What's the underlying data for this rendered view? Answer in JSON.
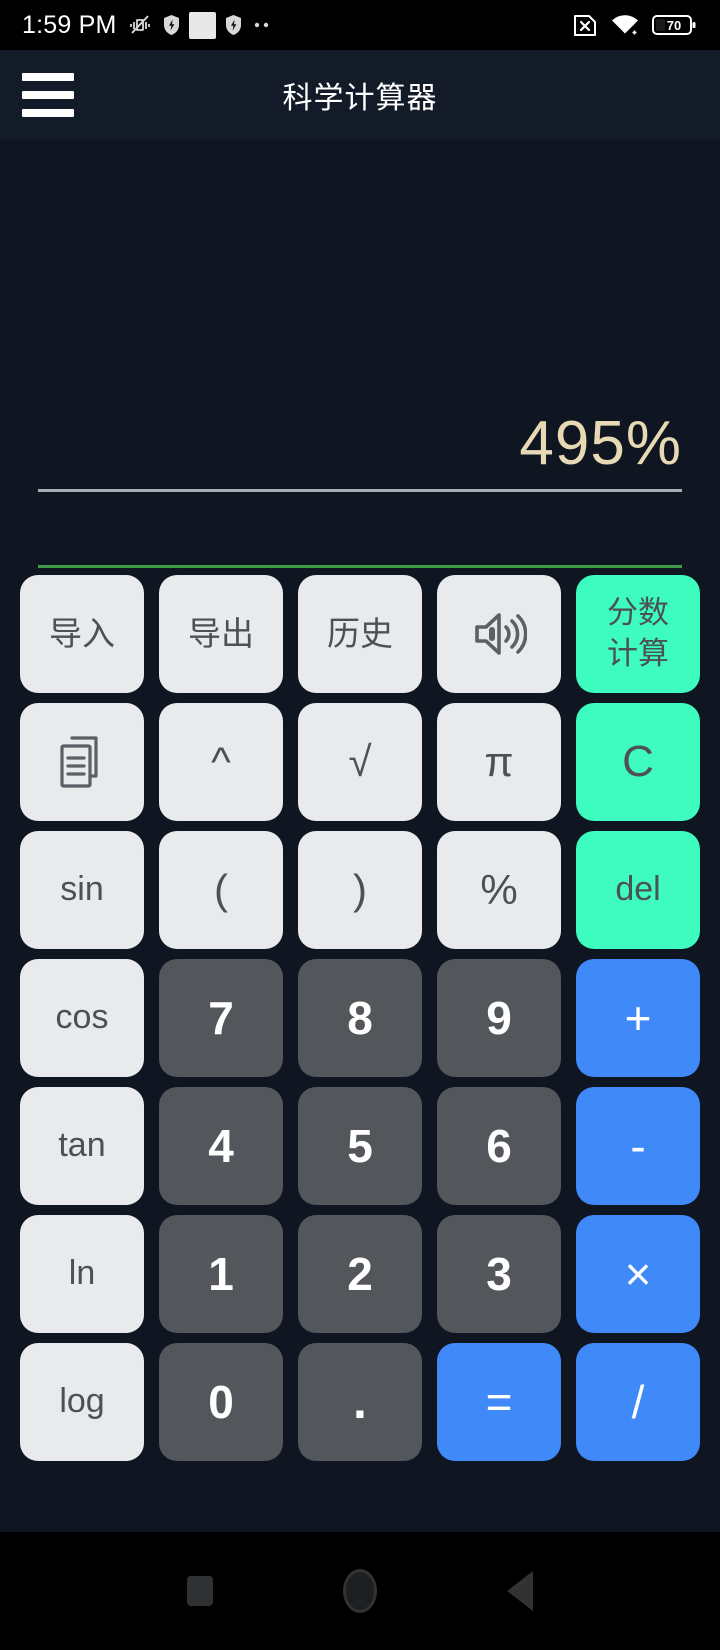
{
  "status_bar": {
    "time": "1:59 PM",
    "left_icons": [
      "vibrate-off-icon",
      "shield-icon",
      "app-white-square-icon",
      "shield-icon",
      "more-dots-icon"
    ],
    "right_icons": [
      "sim-x-icon",
      "wifi-icon",
      "battery-icon"
    ],
    "battery_level": "70"
  },
  "app_bar": {
    "menu_icon": "hamburger-menu-icon",
    "title": "科学计算器"
  },
  "display": {
    "expression": "495%",
    "result": "",
    "expression_color": "#e6d9b4",
    "rule_top_color": "#a8adb8",
    "rule_bottom_color": "#3f9b47"
  },
  "keypad": {
    "rows": [
      [
        {
          "label": "导入",
          "name": "key-import",
          "style": "light-cjk"
        },
        {
          "label": "导出",
          "name": "key-export",
          "style": "light-cjk"
        },
        {
          "label": "历史",
          "name": "key-history",
          "style": "light-cjk"
        },
        {
          "label": "",
          "name": "key-sound",
          "style": "light-icon",
          "icon": "speaker-volume-icon"
        },
        {
          "label": "分数\n计算",
          "name": "key-fraction-calc",
          "style": "green-cjk"
        }
      ],
      [
        {
          "label": "",
          "name": "key-copy",
          "style": "light-icon",
          "icon": "copy-documents-icon"
        },
        {
          "label": "^",
          "name": "key-power",
          "style": "light-sym"
        },
        {
          "label": "√",
          "name": "key-sqrt",
          "style": "light-sym"
        },
        {
          "label": "π",
          "name": "key-pi",
          "style": "light-sym"
        },
        {
          "label": "C",
          "name": "key-clear",
          "style": "green-big"
        }
      ],
      [
        {
          "label": "sin",
          "name": "key-sin",
          "style": "light"
        },
        {
          "label": "(",
          "name": "key-paren-open",
          "style": "light-sym"
        },
        {
          "label": ")",
          "name": "key-paren-close",
          "style": "light-sym"
        },
        {
          "label": "%",
          "name": "key-percent",
          "style": "light-sym"
        },
        {
          "label": "del",
          "name": "key-delete",
          "style": "green"
        }
      ],
      [
        {
          "label": "cos",
          "name": "key-cos",
          "style": "light"
        },
        {
          "label": "7",
          "name": "key-7",
          "style": "dark"
        },
        {
          "label": "8",
          "name": "key-8",
          "style": "dark"
        },
        {
          "label": "9",
          "name": "key-9",
          "style": "dark"
        },
        {
          "label": "+",
          "name": "key-plus",
          "style": "blue"
        }
      ],
      [
        {
          "label": "tan",
          "name": "key-tan",
          "style": "light"
        },
        {
          "label": "4",
          "name": "key-4",
          "style": "dark"
        },
        {
          "label": "5",
          "name": "key-5",
          "style": "dark"
        },
        {
          "label": "6",
          "name": "key-6",
          "style": "dark"
        },
        {
          "label": "-",
          "name": "key-minus",
          "style": "blue"
        }
      ],
      [
        {
          "label": "ln",
          "name": "key-ln",
          "style": "light"
        },
        {
          "label": "1",
          "name": "key-1",
          "style": "dark"
        },
        {
          "label": "2",
          "name": "key-2",
          "style": "dark"
        },
        {
          "label": "3",
          "name": "key-3",
          "style": "dark"
        },
        {
          "label": "×",
          "name": "key-multiply",
          "style": "blue"
        }
      ],
      [
        {
          "label": "log",
          "name": "key-log",
          "style": "light"
        },
        {
          "label": "0",
          "name": "key-0",
          "style": "dark"
        },
        {
          "label": ".",
          "name": "key-decimal",
          "style": "dark-dot"
        },
        {
          "label": "=",
          "name": "key-equals",
          "style": "blue"
        },
        {
          "label": "/",
          "name": "key-divide",
          "style": "blue"
        }
      ]
    ]
  },
  "nav_bar": {
    "recents_icon": "recents-square-icon",
    "home_icon": "home-circle-icon",
    "back_icon": "back-triangle-icon"
  },
  "colors": {
    "background": "#0f1622",
    "app_bar": "#131b29",
    "key_light": "#e9eaec",
    "key_dark": "#53565a",
    "key_green": "#3dfcbe",
    "key_blue": "#3f89f9",
    "status_bar": "#000000"
  }
}
